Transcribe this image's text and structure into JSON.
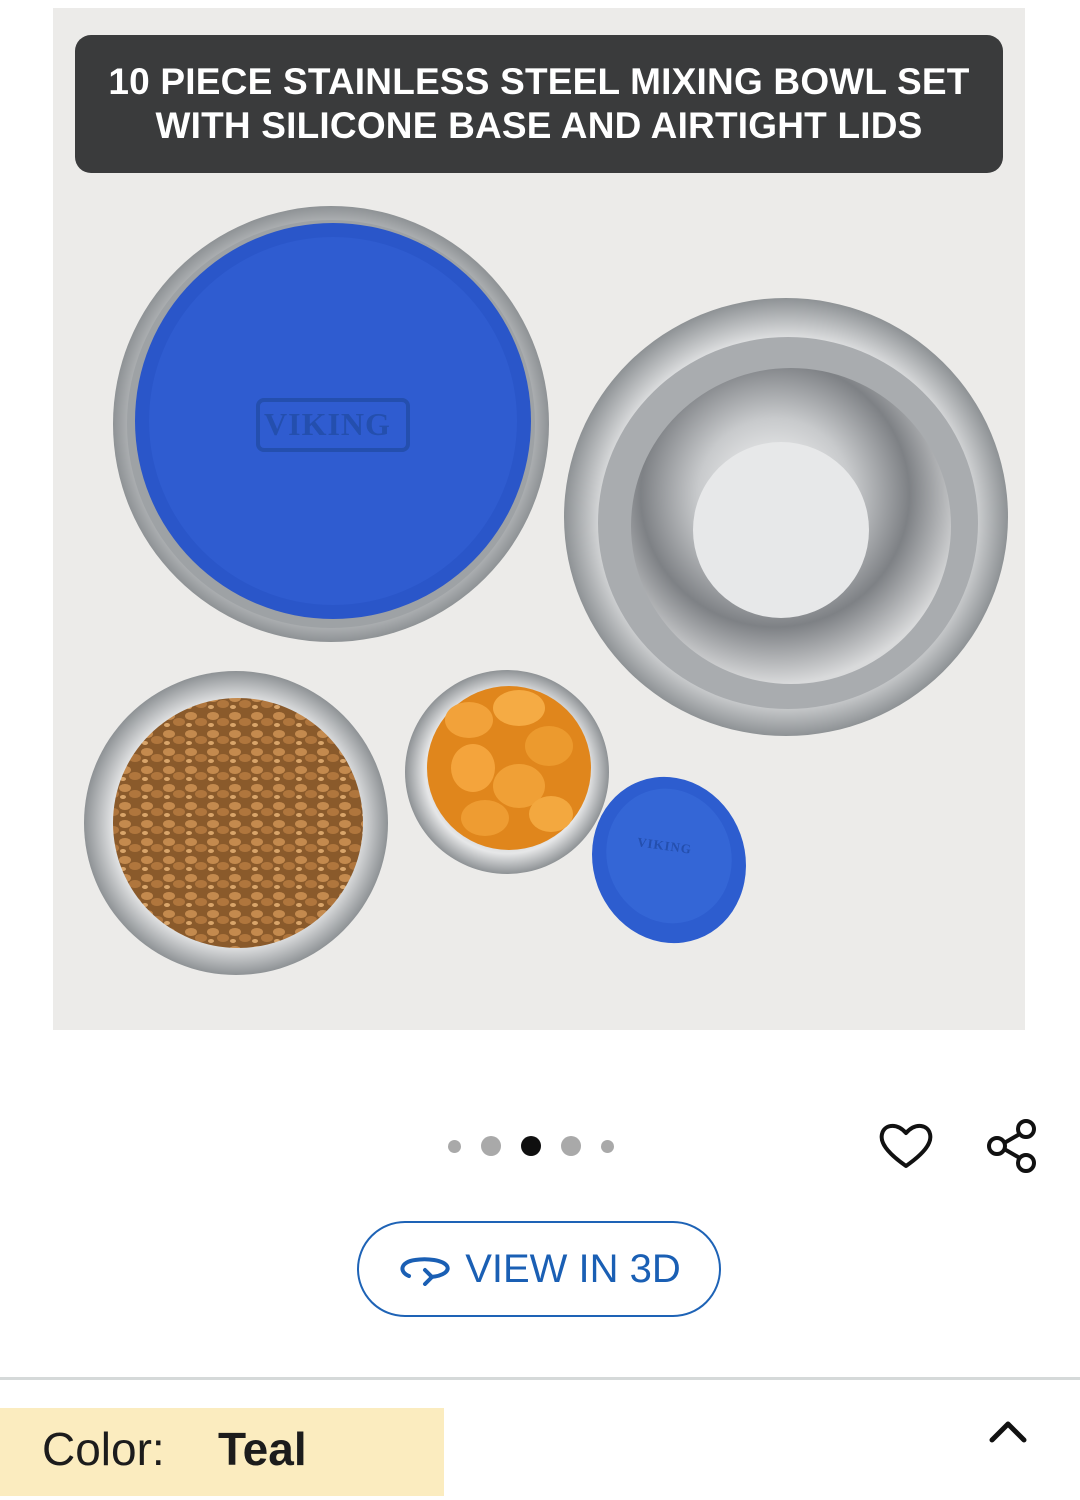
{
  "product_image": {
    "banner_line1": "10 PIECE STAINLESS STEEL MIXING BOWL SET",
    "banner_line2": "WITH SILICONE BASE AND AIRTIGHT LIDS",
    "lid_brand_large": "VIKING",
    "lid_brand_small": "VIKING"
  },
  "carousel": {
    "total": 5,
    "active_index": 3
  },
  "actions": {
    "wishlist_icon": "heart-icon",
    "share_icon": "share-icon"
  },
  "view3d": {
    "label": "VIEW IN 3D",
    "icon": "rotate-3d-icon"
  },
  "color_selector": {
    "label": "Color:",
    "value": "Teal",
    "toggle_icon": "chevron-up-icon"
  },
  "colors": {
    "accent": "#1a5fb4",
    "highlight": "#fbecbf",
    "lid_blue": "#2a56c9",
    "banner": "#3a3b3c"
  }
}
